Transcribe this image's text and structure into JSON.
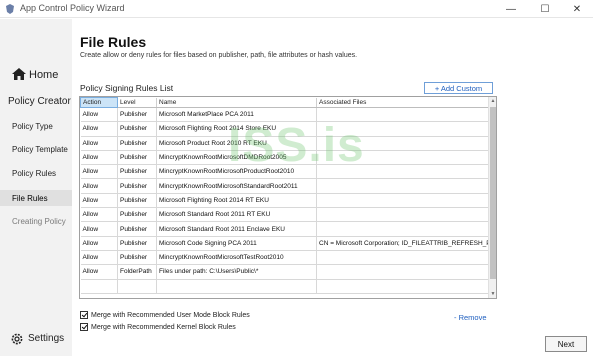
{
  "window": {
    "title": "App Control Policy Wizard",
    "minimize_glyph": "—",
    "maximize_glyph": "☐",
    "close_glyph": "✕",
    "icon": "app-shield-icon"
  },
  "sidebar": {
    "home_label": "Home",
    "group_label": "Policy Creator",
    "items": [
      {
        "label": "Policy Type"
      },
      {
        "label": "Policy Template"
      },
      {
        "label": "Policy Rules"
      },
      {
        "label": "File Rules"
      },
      {
        "label": "Creating Policy"
      }
    ],
    "settings_label": "Settings"
  },
  "main": {
    "title": "File Rules",
    "description": "Create allow or deny rules for files based on publisher, path, file attributes or hash values.",
    "list_title": "Policy Signing Rules List",
    "add_custom_label": "+ Add Custom",
    "table": {
      "columns": [
        "Action",
        "Level",
        "Name",
        "Associated Files"
      ],
      "rows": [
        [
          "Allow",
          "Publisher",
          "Microsoft MarketPlace PCA 2011",
          ""
        ],
        [
          "Allow",
          "Publisher",
          "Microsoft Flighting Root 2014 Store EKU",
          ""
        ],
        [
          "Allow",
          "Publisher",
          "Microsoft Product Root 2010 RT EKU",
          ""
        ],
        [
          "Allow",
          "Publisher",
          "MincryptKnownRootMicrosoftDMDRoot2005",
          ""
        ],
        [
          "Allow",
          "Publisher",
          "MincryptKnownRootMicrosoftProductRoot2010",
          ""
        ],
        [
          "Allow",
          "Publisher",
          "MincryptKnownRootMicrosoftStandardRoot2011",
          ""
        ],
        [
          "Allow",
          "Publisher",
          "Microsoft Flighting Root 2014 RT EKU",
          ""
        ],
        [
          "Allow",
          "Publisher",
          "Microsoft Standard Root 2011 RT EKU",
          ""
        ],
        [
          "Allow",
          "Publisher",
          "Microsoft Standard Root 2011 Enclave EKU",
          ""
        ],
        [
          "Allow",
          "Publisher",
          "Microsoft Code Signing PCA 2011",
          "CN = Microsoft Corporation; ID_FILEATTRIB_REFRESH_POLICY"
        ],
        [
          "Allow",
          "Publisher",
          "MincryptKnownRootMicrosoftTestRoot2010",
          ""
        ],
        [
          "Allow",
          "FolderPath",
          "Files under path: C:\\Users\\Public\\*",
          ""
        ]
      ]
    },
    "checkboxes": [
      {
        "label": "Merge with Recommended User Mode Block Rules",
        "checked": true
      },
      {
        "label": "Merge with Recommended Kernel Block Rules",
        "checked": true
      }
    ],
    "remove_label": "- Remove",
    "next_label": "Next"
  },
  "watermark": "ISS.is",
  "colors": {
    "accent": "#1f5fbf",
    "sidebar_bg": "#f2f2f2",
    "selected_header": "#cce4f7"
  }
}
